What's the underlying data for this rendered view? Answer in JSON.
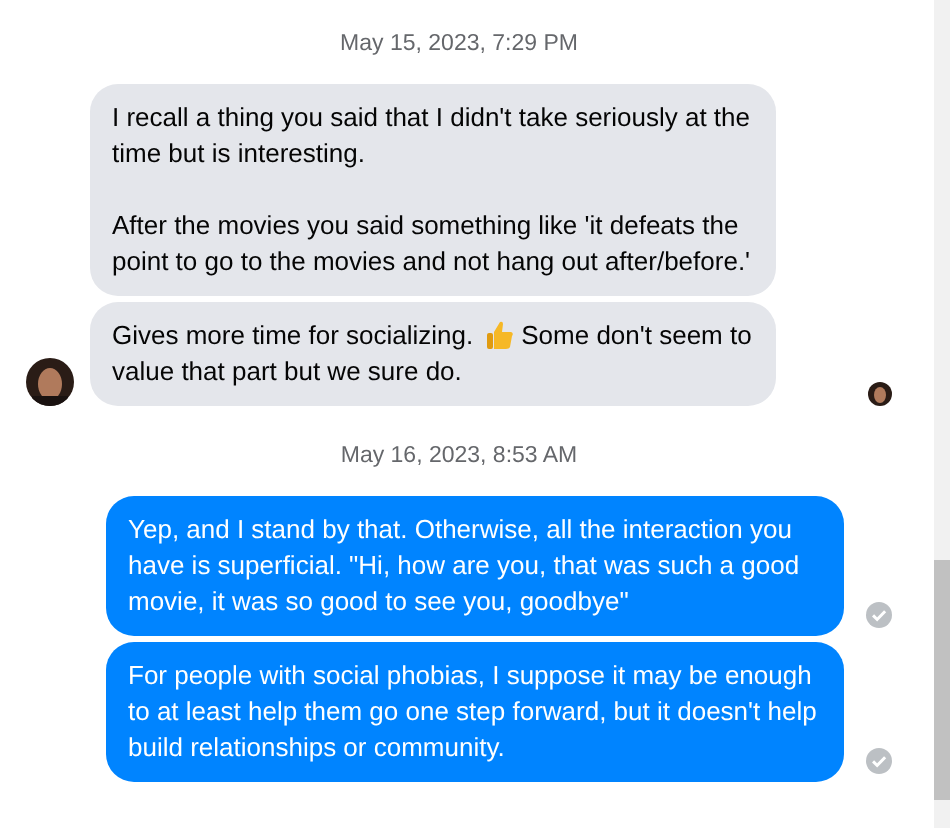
{
  "conversation": [
    {
      "kind": "date",
      "text": "May 15, 2023, 7:29 PM"
    },
    {
      "kind": "incoming",
      "show_avatar": false,
      "seen": false,
      "paragraphs": [
        [
          {
            "kind": "text",
            "text": "I recall a thing you said that I didn't take seriously at the time but is interesting."
          }
        ],
        [
          {
            "kind": "text",
            "text": "After the movies you said something like 'it defeats the point to go to the movies and not hang out after/before.'"
          }
        ]
      ]
    },
    {
      "kind": "incoming",
      "show_avatar": true,
      "seen": true,
      "paragraphs": [
        [
          {
            "kind": "text",
            "text": "Gives more time for socializing."
          },
          {
            "kind": "emoji"
          },
          {
            "kind": "text",
            "text": "Some don't seem to value that part but we sure do."
          }
        ]
      ]
    },
    {
      "kind": "date",
      "text": "May 16, 2023, 8:53 AM"
    },
    {
      "kind": "outgoing",
      "delivered": true,
      "paragraphs": [
        [
          {
            "kind": "text",
            "text": "Yep, and I stand by that. Otherwise, all the interaction you have is superficial. \"Hi, how are you, that was such a good movie, it was so good to see you, goodbye\""
          }
        ]
      ]
    },
    {
      "kind": "outgoing",
      "delivered": true,
      "paragraphs": [
        [
          {
            "kind": "text",
            "text": "For people with social phobias, I suppose it may be enough to at least help them go one step forward, but it doesn't help build relationships or community."
          }
        ]
      ]
    }
  ]
}
